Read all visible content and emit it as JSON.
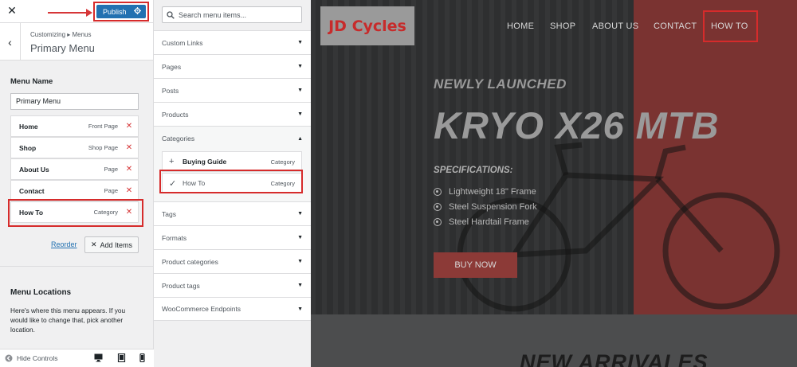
{
  "customizer": {
    "publish_label": "Publish",
    "breadcrumb": "Customizing ▸ Menus",
    "panel_title": "Primary Menu",
    "menu_name_label": "Menu Name",
    "menu_name_value": "Primary Menu",
    "menu_items": [
      {
        "title": "Home",
        "kind": "Front Page"
      },
      {
        "title": "Shop",
        "kind": "Shop Page"
      },
      {
        "title": "About Us",
        "kind": "Page"
      },
      {
        "title": "Contact",
        "kind": "Page"
      },
      {
        "title": "How To",
        "kind": "Category"
      }
    ],
    "reorder_label": "Reorder",
    "add_items_label": "Add Items",
    "locations_title": "Menu Locations",
    "locations_desc": "Here's where this menu appears. If you would like to change that, pick another location.",
    "hide_controls_label": "Hide Controls"
  },
  "add_items_panel": {
    "search_placeholder": "Search menu items...",
    "sections_top": [
      "Custom Links",
      "Pages",
      "Posts",
      "Products"
    ],
    "open_section": "Categories",
    "category_items": [
      {
        "title": "Buying Guide",
        "kind": "Category",
        "added": false
      },
      {
        "title": "How To",
        "kind": "Category",
        "added": true
      }
    ],
    "sections_bottom": [
      "Tags",
      "Formats",
      "Product categories",
      "Product tags",
      "WooCommerce Endpoints"
    ]
  },
  "preview": {
    "logo_text": "JD Cycles",
    "nav": [
      "HOME",
      "SHOP",
      "ABOUT US",
      "CONTACT",
      "HOW TO"
    ],
    "eyebrow": "NEWLY LAUNCHED",
    "headline": "KRYO X26 MTB",
    "spec_title": "SPECIFICATIONS:",
    "specs": [
      "Lightweight 18\" Frame",
      "Steel Suspension Fork",
      "Steel Hardtail Frame"
    ],
    "cta": "BUY NOW",
    "section_heading": "NEW ARRIVALES"
  },
  "colors": {
    "accent_blue": "#2271b1",
    "highlight_red": "#d62b2b",
    "delete_red": "#d63638",
    "logo_red": "#c72b2b"
  }
}
